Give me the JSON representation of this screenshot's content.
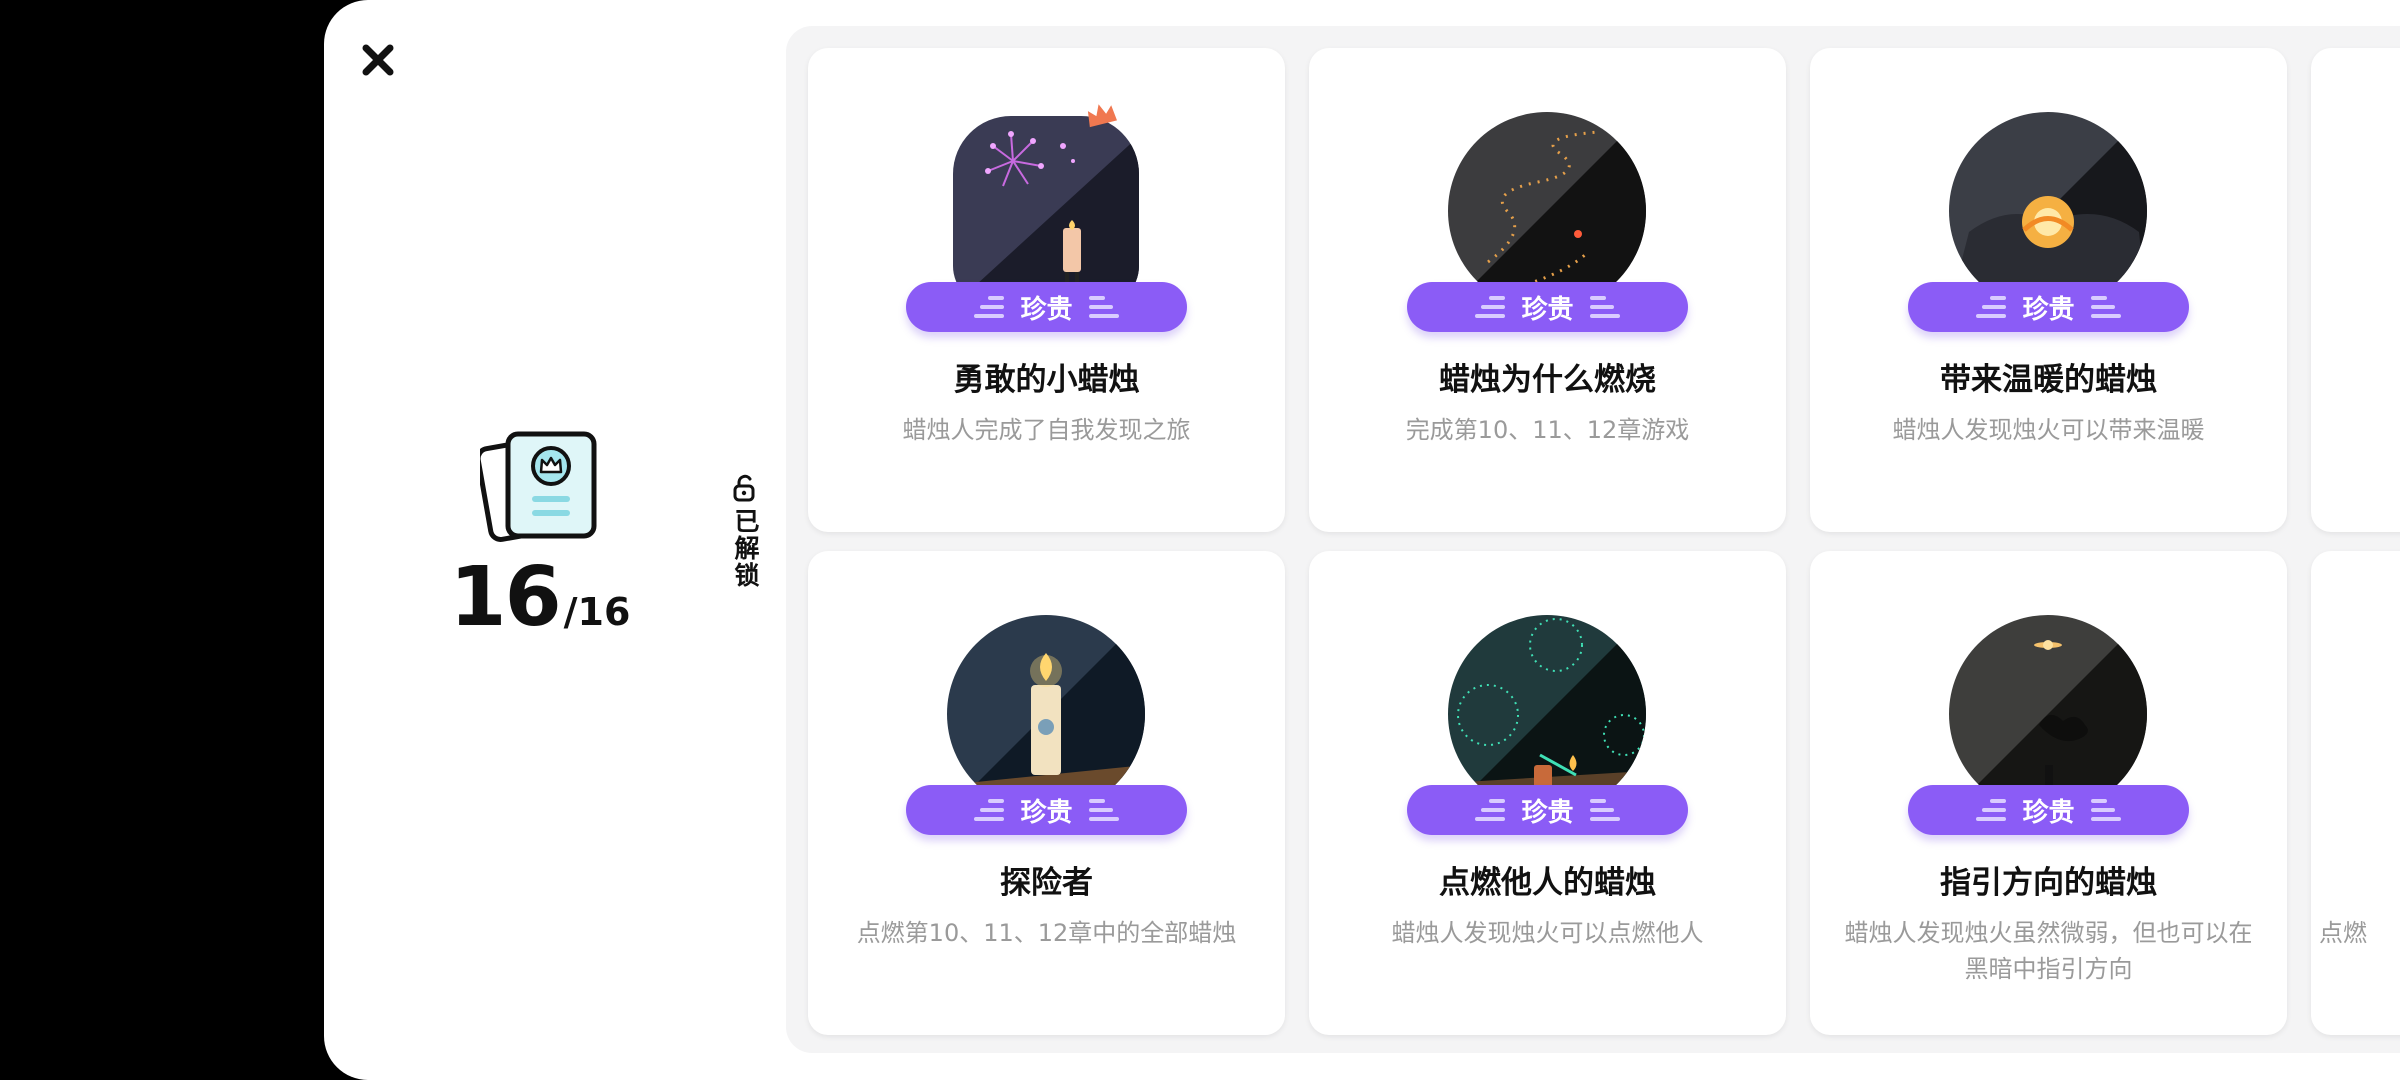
{
  "summary": {
    "unlocked": "16",
    "total": "/16"
  },
  "unlock_tab": {
    "label": "已解锁"
  },
  "cards": [
    {
      "badge": "珍贵",
      "title": "勇敢的小蜡烛",
      "desc": "蜡烛人完成了自我发现之旅"
    },
    {
      "badge": "珍贵",
      "title": "蜡烛为什么燃烧",
      "desc": "完成第10、11、12章游戏"
    },
    {
      "badge": "珍贵",
      "title": "带来温暖的蜡烛",
      "desc": "蜡烛人发现烛火可以带来温暖"
    },
    {
      "badge": "珍贵",
      "title": "探险者",
      "desc": "点燃第10、11、12章中的全部蜡烛"
    },
    {
      "badge": "珍贵",
      "title": "点燃他人的蜡烛",
      "desc": "蜡烛人发现烛火可以点燃他人"
    },
    {
      "badge": "珍贵",
      "title": "指引方向的蜡烛",
      "desc": "蜡烛人发现烛火虽然微弱，但也可以在黑暗中指引方向"
    },
    {
      "partial_desc": "点燃"
    }
  ],
  "colors": {
    "badge": "#8b5cf6",
    "grid_bg": "#f4f4f5",
    "desc": "#9a9a9a",
    "crown": "#f07850"
  }
}
